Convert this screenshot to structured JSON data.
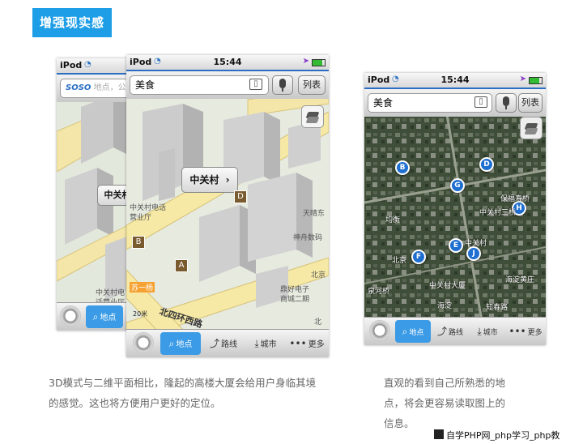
{
  "section_title": "增强现实感",
  "phones": {
    "back": {
      "carrier": "iPod",
      "search_logo": "SOSO",
      "search_placeholder": "地点，公",
      "callout": "中关村",
      "labels": [
        "中关村电话",
        "营业厅",
        "中关村电",
        "话营业厅"
      ],
      "toolbar": {
        "search": "地点"
      }
    },
    "front": {
      "carrier": "iPod",
      "time": "15:44",
      "search_value": "美食",
      "list_button": "列表",
      "callout": "中关村",
      "callout_arrow": "›",
      "poi_markers": [
        "D",
        "B",
        "A"
      ],
      "labels": [
        "中关村电话",
        "营业厅",
        "天晴东",
        "神舟数码",
        "鼎好电子",
        "商城二期",
        "北四环西路",
        "北京",
        "北京",
        "20米",
        "苏一杨",
        "北"
      ],
      "toolbar": {
        "search": "地点",
        "route": "路线",
        "city": "城市",
        "more": "更多"
      }
    },
    "satellite": {
      "carrier": "iPod",
      "time": "15:44",
      "search_value": "美食",
      "list_button": "列表",
      "pins": [
        "B",
        "D",
        "G",
        "H",
        "F",
        "E",
        "J"
      ],
      "labels": [
        "保福寿桥",
        "中关村三桥",
        "中关村",
        "北京",
        "均衡",
        "海淀黄庄",
        "泉河桥",
        "中关村大厦",
        "海淀",
        "知春路"
      ],
      "toolbar": {
        "search": "地点",
        "route": "路线",
        "city": "城市",
        "more": "更多"
      }
    }
  },
  "captions": {
    "left": [
      "3D模式与二维平面相比，隆起的高楼大厦会给用户身临其境",
      "的感觉。这也将方便用户更好的定位。"
    ],
    "right": [
      "直观的看到自己所熟悉的地",
      "点，将会更容易读取图上的",
      "信息。"
    ]
  },
  "watermark": "自学PHP网_php学习_php教"
}
